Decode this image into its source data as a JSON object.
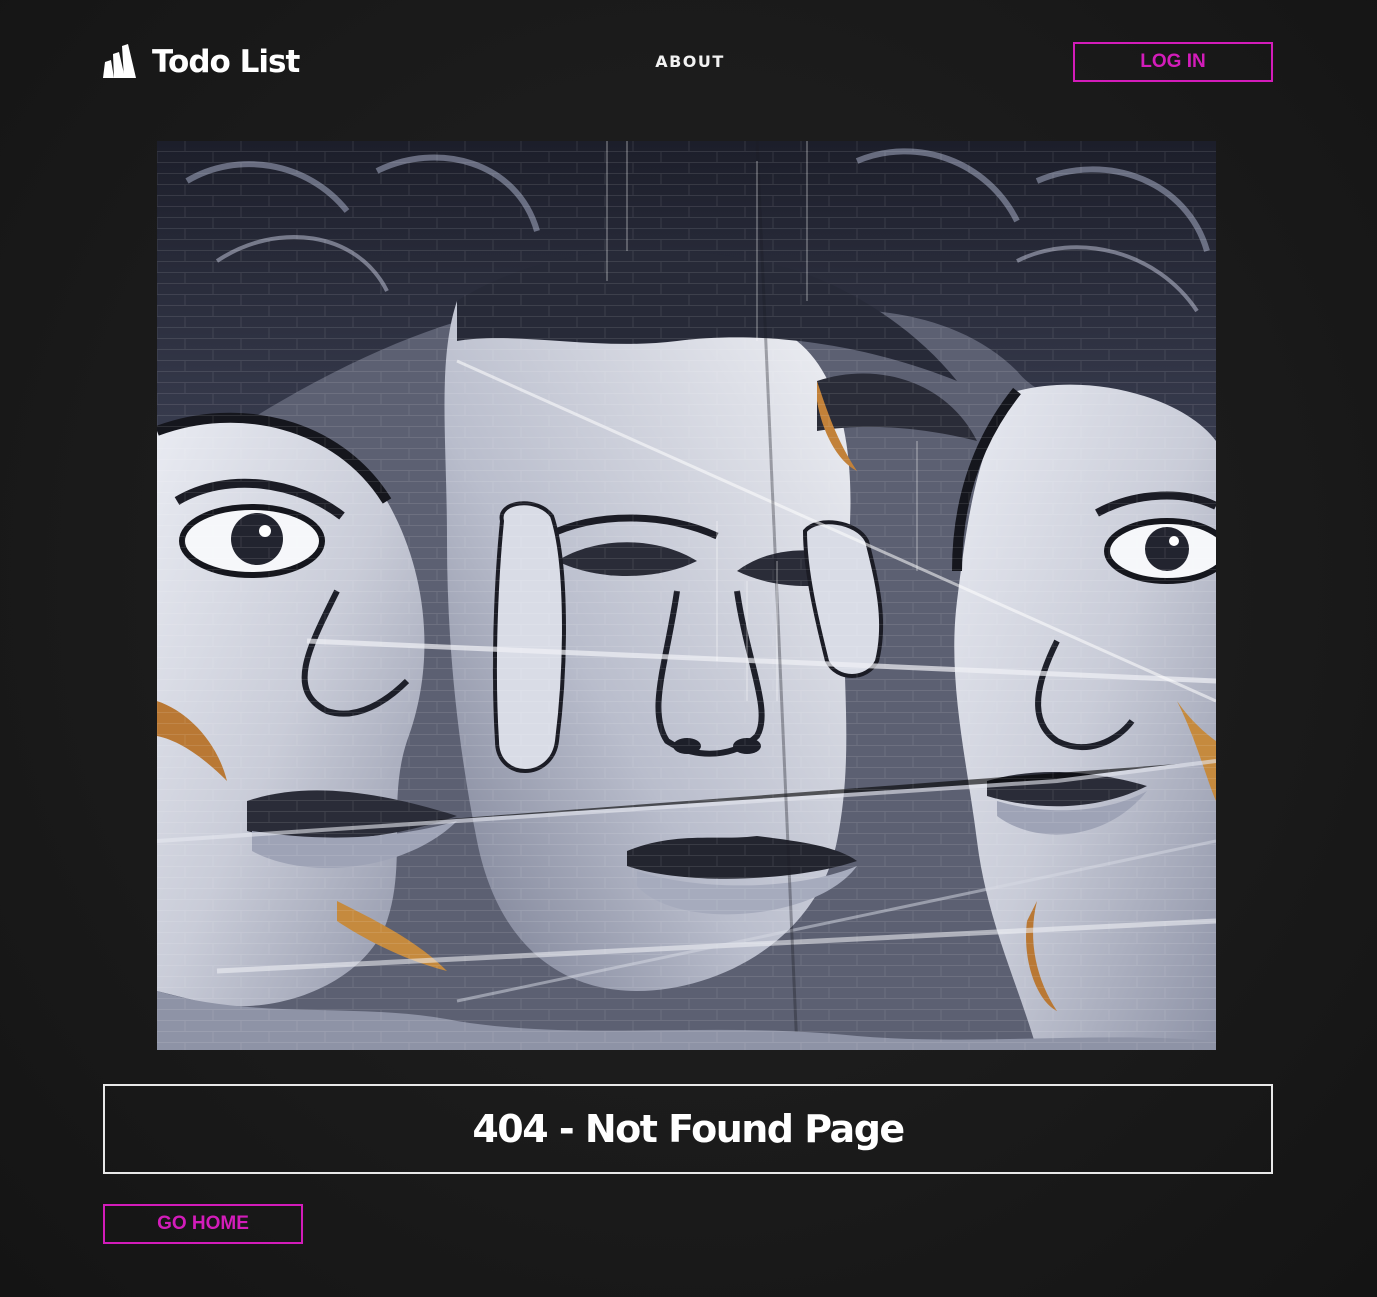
{
  "header": {
    "brand_name": "Todo List",
    "logo_icon": "brand-stripes-icon",
    "nav": [
      {
        "label": "ABOUT"
      }
    ],
    "login_label": "LOG IN"
  },
  "main": {
    "image_alt": "Black and white street-art mural of fragmented faces",
    "title": "404 - Not Found Page",
    "go_home_label": "GO HOME"
  },
  "colors": {
    "background": "#1b1b1b",
    "accent": "#d31cba",
    "text": "#ffffff",
    "border": "#e8e8e8"
  }
}
